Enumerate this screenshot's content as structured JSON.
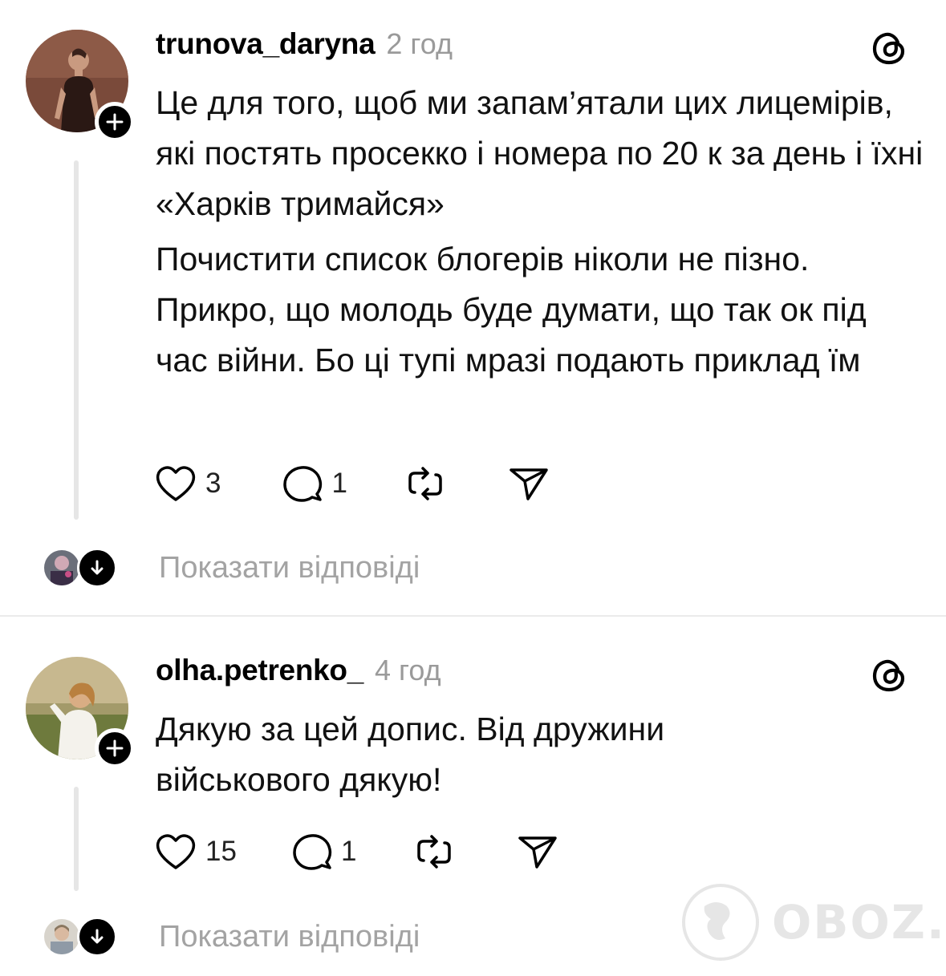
{
  "posts": [
    {
      "username": "trunova_daryna",
      "time": "2 год",
      "paragraphs": [
        "Це для того, щоб ми запам’ятали цих лицемірів, які постять просекко і номера по 20 к за день і їхні «Харків тримайся»",
        "Почистити список блогерів ніколи не пізно. Прикро, що молодь буде думати, що так ок під час війни. Бо ці тупі мразі подають приклад їм"
      ],
      "likes": "3",
      "comments": "1",
      "show_replies": "Показати відповіді"
    },
    {
      "username": "olha.petrenko_",
      "time": "4 год",
      "paragraphs": [
        "Дякую за цей допис. Від дружини військового дякую!"
      ],
      "likes": "15",
      "comments": "1",
      "show_replies": "Показати відповіді"
    }
  ],
  "watermark": "OBOZ.UA",
  "icons": {
    "platform": "threads-icon",
    "like": "heart-icon",
    "comment": "comment-icon",
    "repost": "repost-icon",
    "share": "send-icon",
    "follow": "plus-icon",
    "expand": "arrow-down-icon"
  }
}
